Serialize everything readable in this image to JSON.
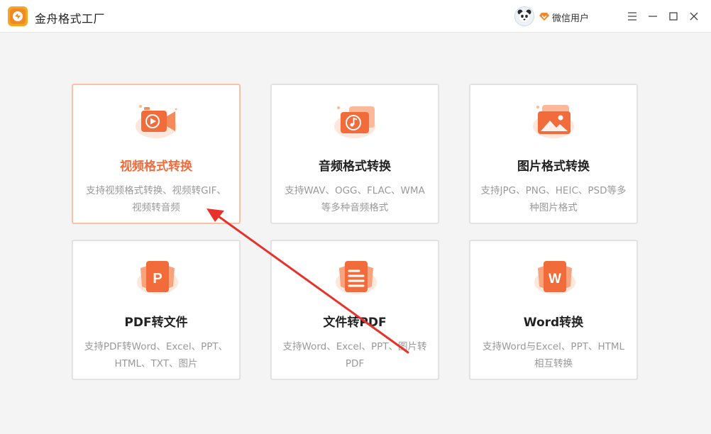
{
  "app": {
    "title": "金舟格式工厂",
    "user_name": "微信用户"
  },
  "window_controls": [
    "menu-icon",
    "minimize-icon",
    "maximize-icon",
    "close-icon"
  ],
  "cards": [
    {
      "title": "视频格式转换",
      "desc": "支持视频格式转换、视频转GIF、视频转音频",
      "icon": "video-icon",
      "active": true
    },
    {
      "title": "音频格式转换",
      "desc": "支持WAV、OGG、FLAC、WMA等多种音频格式",
      "icon": "audio-icon",
      "active": false
    },
    {
      "title": "图片格式转换",
      "desc": "支持JPG、PNG、HEIC、PSD等多种图片格式",
      "icon": "image-icon",
      "active": false
    },
    {
      "title": "PDF转文件",
      "desc": "支持PDF转Word、Excel、PPT、HTML、TXT、图片",
      "icon": "pdf-icon",
      "active": false
    },
    {
      "title": "文件转PDF",
      "desc": "支持Word、Excel、PPT、图片转PDF",
      "icon": "file-icon",
      "active": false
    },
    {
      "title": "Word转换",
      "desc": "支持Word与Excel、PPT、HTML相互转换",
      "icon": "word-icon",
      "active": false
    }
  ],
  "colors": {
    "accent": "#f26b3a",
    "accent_light": "#fbb999",
    "arrow": "#e8312a"
  }
}
